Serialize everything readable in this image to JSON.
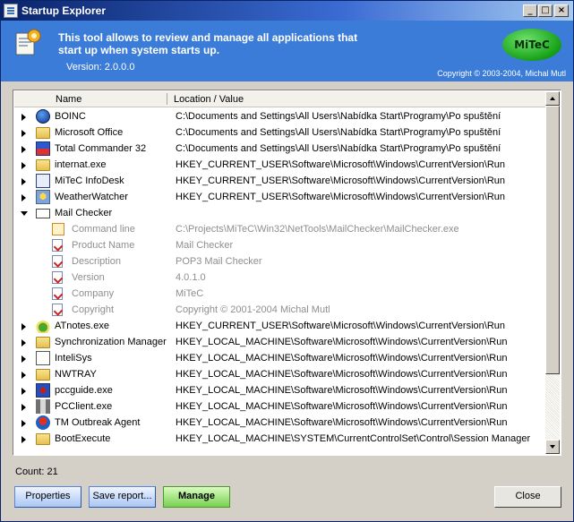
{
  "window": {
    "title": "Startup Explorer"
  },
  "banner": {
    "description": "This tool allows to review and manage all applications that start up when system starts up.",
    "version": "Version: 2.0.0.0",
    "copyright": "Copyright © 2003-2004, Michal Mutl",
    "logo_text": "MiTeC"
  },
  "columns": {
    "name": "Name",
    "location": "Location / Value"
  },
  "rows": [
    {
      "name": "BOINC",
      "value": "C:\\Documents and Settings\\All Users\\Nabídka Start\\Programy\\Po spuštění",
      "icon": "boinc-icon"
    },
    {
      "name": "Microsoft Office",
      "value": "C:\\Documents and Settings\\All Users\\Nabídka Start\\Programy\\Po spuštění",
      "icon": "folder-icon"
    },
    {
      "name": "Total Commander 32",
      "value": "C:\\Documents and Settings\\All Users\\Nabídka Start\\Programy\\Po spuštění",
      "icon": "floppy-icon"
    },
    {
      "name": "internat.exe",
      "value": "HKEY_CURRENT_USER\\Software\\Microsoft\\Windows\\CurrentVersion\\Run",
      "icon": "folder-icon"
    },
    {
      "name": "MiTeC InfoDesk",
      "value": "HKEY_CURRENT_USER\\Software\\Microsoft\\Windows\\CurrentVersion\\Run",
      "icon": "infodesk-icon"
    },
    {
      "name": "WeatherWatcher",
      "value": "HKEY_CURRENT_USER\\Software\\Microsoft\\Windows\\CurrentVersion\\Run",
      "icon": "weather-icon"
    },
    {
      "name": "Mail Checker",
      "value": "",
      "icon": "mail-icon"
    }
  ],
  "details": [
    {
      "name": "Command line",
      "value": "C:\\Projects\\MiTeC\\Win32\\NetTools\\MailChecker\\MailChecker.exe"
    },
    {
      "name": "Product Name",
      "value": "Mail Checker"
    },
    {
      "name": "Description",
      "value": "POP3 Mail Checker"
    },
    {
      "name": "Version",
      "value": "4.0.1.0"
    },
    {
      "name": "Company",
      "value": "MiTeC"
    },
    {
      "name": "Copyright",
      "value": "Copyright © 2001-2004 Michal Mutl"
    }
  ],
  "rows2": [
    {
      "name": "ATnotes.exe",
      "value": "HKEY_CURRENT_USER\\Software\\Microsoft\\Windows\\CurrentVersion\\Run",
      "icon": "atnotes-icon"
    },
    {
      "name": "Synchronization Manager",
      "value": "HKEY_LOCAL_MACHINE\\Software\\Microsoft\\Windows\\CurrentVersion\\Run",
      "icon": "folder-icon"
    },
    {
      "name": "InteliSys",
      "value": "HKEY_LOCAL_MACHINE\\Software\\Microsoft\\Windows\\CurrentVersion\\Run",
      "icon": "intelisys-icon"
    },
    {
      "name": "NWTRAY",
      "value": "HKEY_LOCAL_MACHINE\\Software\\Microsoft\\Windows\\CurrentVersion\\Run",
      "icon": "folder-icon"
    },
    {
      "name": "pccguide.exe",
      "value": "HKEY_LOCAL_MACHINE\\Software\\Microsoft\\Windows\\CurrentVersion\\Run",
      "icon": "pccguide-icon"
    },
    {
      "name": "PCClient.exe",
      "value": "HKEY_LOCAL_MACHINE\\Software\\Microsoft\\Windows\\CurrentVersion\\Run",
      "icon": "plug-icon"
    },
    {
      "name": "TM Outbreak Agent",
      "value": "HKEY_LOCAL_MACHINE\\Software\\Microsoft\\Windows\\CurrentVersion\\Run",
      "icon": "outbreak-icon"
    },
    {
      "name": "BootExecute",
      "value": "HKEY_LOCAL_MACHINE\\SYSTEM\\CurrentControlSet\\Control\\Session Manager",
      "icon": "folder-icon"
    }
  ],
  "status": {
    "count": "Count: 21"
  },
  "buttons": {
    "properties": "Properties",
    "save_report": "Save report...",
    "manage": "Manage",
    "close": "Close"
  }
}
